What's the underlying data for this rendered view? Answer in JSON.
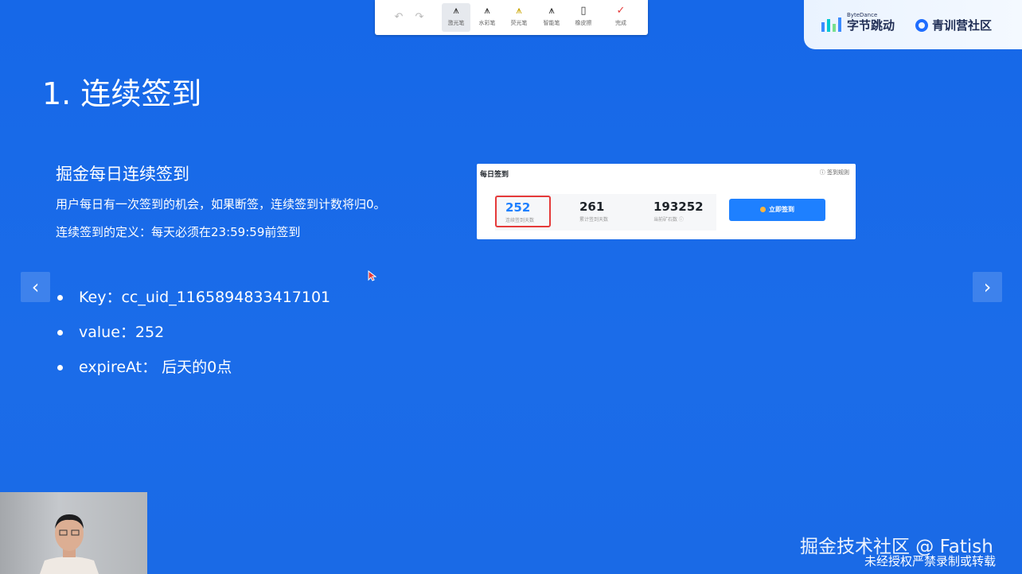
{
  "toolbar": {
    "undo_glyph": "↶",
    "redo_glyph": "↷",
    "tools": [
      {
        "label": "激光笔",
        "icon": "laser-pen-icon",
        "glyph": "⩚"
      },
      {
        "label": "水彩笔",
        "icon": "watercolor-pen-icon",
        "glyph": "⩚"
      },
      {
        "label": "荧光笔",
        "icon": "highlighter-icon",
        "glyph": "⩚"
      },
      {
        "label": "智能笔",
        "icon": "smart-pen-icon",
        "glyph": "⩚"
      },
      {
        "label": "橡皮擦",
        "icon": "eraser-icon",
        "glyph": "▯"
      },
      {
        "label": "完成",
        "icon": "checkmark-icon",
        "glyph": "✓"
      }
    ]
  },
  "brand": {
    "bytedance_sub": "ByteDance",
    "bytedance_name": "字节跳动",
    "qingxun_name": "青训营社区"
  },
  "slide": {
    "title": "1. 连续签到",
    "subtitle": "掘金每日连续签到",
    "para1": "用户每日有一次签到的机会，如果断签，连续签到计数将归0。",
    "para2": "连续签到的定义：每天必须在23:59:59前签到",
    "bullets": [
      "Key：cc_uid_1165894833417101",
      "value：252",
      "expireAt： 后天的0点"
    ],
    "prev_glyph": "‹",
    "next_glyph": "›"
  },
  "card": {
    "title": "每日签到",
    "rules": "ⓘ 签到规则",
    "stats": [
      {
        "value": "252",
        "caption": "连续签到天数"
      },
      {
        "value": "261",
        "caption": "累计签到天数"
      },
      {
        "value": "193252",
        "caption": "当前矿石数 ⓘ"
      }
    ],
    "button": "立即签到"
  },
  "watermark": {
    "line1": "掘金技术社区 @ Fatish",
    "line2": "未经授权严禁录制或转载"
  },
  "colors": {
    "slide_bg": "#1a6ae8",
    "accent": "#1e80ff",
    "highlight_border": "#e53a3a"
  }
}
